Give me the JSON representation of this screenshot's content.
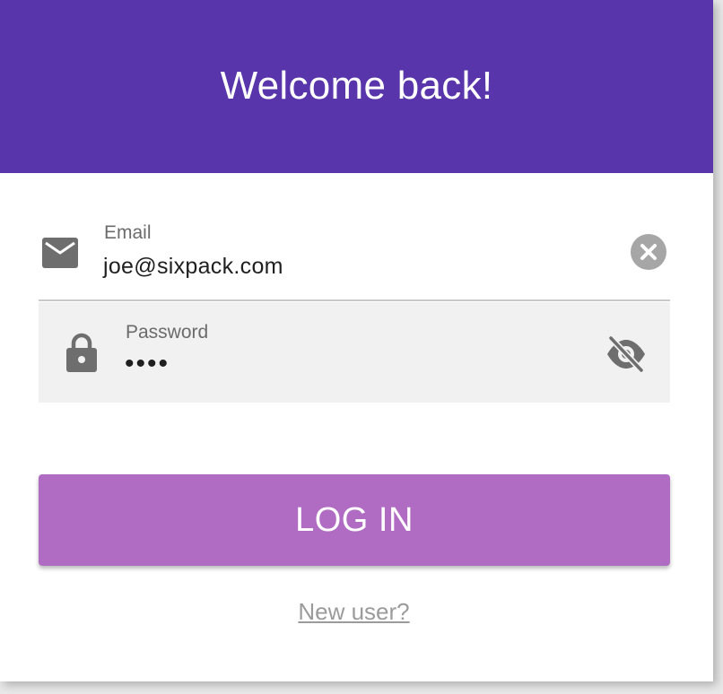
{
  "header": {
    "title": "Welcome back!",
    "background_color": "#5835ab"
  },
  "email_field": {
    "label": "Email",
    "value": "joe@sixpack.com",
    "icon": "mail-icon",
    "clear_icon": "clear-circle-icon"
  },
  "password_field": {
    "label": "Password",
    "value": "••••",
    "icon": "lock-icon",
    "visibility_icon": "eye-off-icon"
  },
  "login_button": {
    "label": "LOG IN",
    "color": "#b06cc3"
  },
  "new_user_link": {
    "label": "New user?"
  }
}
